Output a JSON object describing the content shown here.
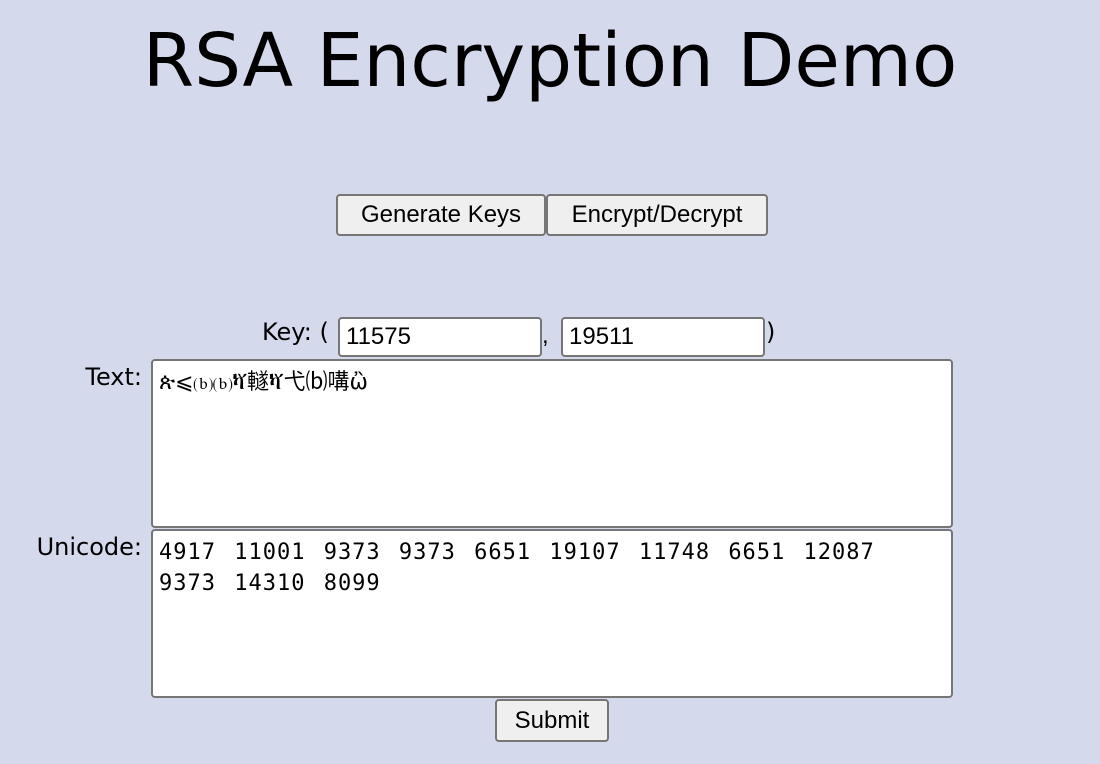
{
  "page": {
    "title": "RSA Encryption Demo",
    "background_color": "#d4daeb"
  },
  "toolbar": {
    "generate_keys_label": "Generate Keys",
    "encrypt_decrypt_label": "Encrypt/Decrypt"
  },
  "key": {
    "label": "Key: (",
    "separator": ",",
    "close": ")",
    "exponent": "11575",
    "modulus": "19511"
  },
  "text": {
    "label": "Text:",
    "value": "ጵ⩽⒝⒝ⷋ䡵ⷋ弋⒝㗕ὢ"
  },
  "unicode": {
    "label": "Unicode:",
    "value": "4917 11001 9373 9373 6651 19107 11748 6651 12087 9373 14310 8099"
  },
  "form": {
    "submit_label": "Submit"
  }
}
